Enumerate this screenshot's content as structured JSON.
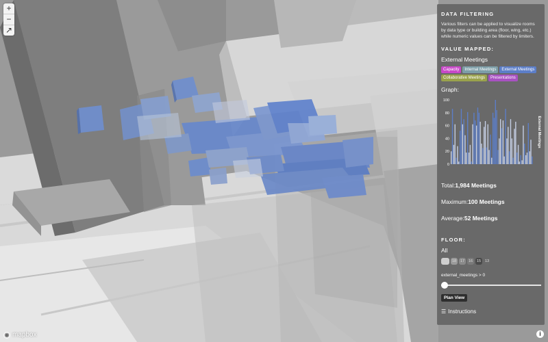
{
  "map": {
    "zoom_in": "+",
    "zoom_out": "−",
    "compass": "↗",
    "logo": "mapbox",
    "info": "i"
  },
  "panel": {
    "title": "DATA FILTERING",
    "description": "Various filters can be applied to visualize rooms by data type or building area (floor, wing, etc.) while numeric values can be filtered by limiters.",
    "value_heading": "VALUE MAPPED:",
    "value_selected": "External Meetings",
    "badges": [
      {
        "label": "Capacity",
        "color": "#c848c8"
      },
      {
        "label": "Internal Meetings",
        "color": "#7d9ea8"
      },
      {
        "label": "External Meetings",
        "color": "#5c7ec8"
      },
      {
        "label": "Collaborative Meetings",
        "color": "#9aa24c"
      },
      {
        "label": "Presentations",
        "color": "#a852c2"
      }
    ],
    "graph_label": "Graph:",
    "stats": {
      "total_label": "Total:",
      "total_value": "1,984 Meetings",
      "max_label": "Maximum:",
      "max_value": "100 Meetings",
      "avg_label": "Average:",
      "avg_value": "52 Meetings"
    },
    "floor_heading": "FLOOR:",
    "floor_all": "All",
    "floors": [
      "",
      "18",
      "17",
      "16",
      "15",
      "13"
    ],
    "filter_text": "external_meetings > 0",
    "slider_value": 0,
    "plan_view": "Plan View",
    "instructions": "Instructions"
  },
  "chart_data": {
    "type": "bar",
    "ylabel": "External Meetings",
    "yticks": [
      0,
      20,
      40,
      60,
      80,
      100
    ],
    "ylim": [
      0,
      100
    ],
    "values": [
      20,
      86,
      30,
      62,
      10,
      28,
      4,
      52,
      86,
      62,
      70,
      45,
      18,
      81,
      18,
      30,
      4,
      62,
      80,
      68,
      60,
      88,
      80,
      66,
      32,
      25,
      58,
      67,
      26,
      62,
      22,
      46,
      10,
      80,
      72,
      100,
      84,
      22,
      40,
      70,
      56,
      68,
      12,
      86,
      40,
      58,
      20,
      70,
      40,
      10,
      55,
      66,
      18,
      30,
      4,
      14,
      6,
      60,
      32,
      14,
      18,
      64,
      20,
      38,
      12
    ],
    "colors": {
      "dark": "#5c7ec8",
      "light": "#c6d0e6"
    }
  }
}
